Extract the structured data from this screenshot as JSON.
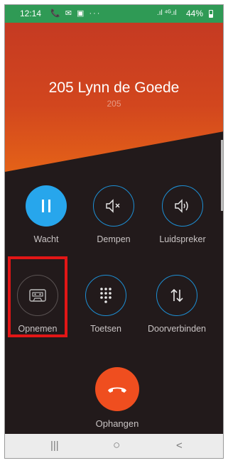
{
  "status_bar": {
    "time": "12:14",
    "left_icons": "📞 ✉ ▣ ···",
    "signal": ".ıl ⁴ᴳ.ıl",
    "battery": "44%"
  },
  "contact": {
    "name": "205 Lynn de Goede",
    "extension": "205"
  },
  "controls": {
    "hold": "Wacht",
    "mute": "Dempen",
    "speaker": "Luidspreker",
    "record": "Opnemen",
    "keypad": "Toetsen",
    "transfer": "Doorverbinden",
    "hangup": "Ophangen"
  },
  "nav": {
    "recents": "|||",
    "home": "○",
    "back": "<"
  },
  "colors": {
    "status_bar": "#2f9a55",
    "hero_top": "#c53a22",
    "hero_bottom": "#e46218",
    "background": "#221a1b",
    "accent_blue": "#27a6ec",
    "hangup": "#ef4e1f",
    "highlight": "#e21616"
  }
}
